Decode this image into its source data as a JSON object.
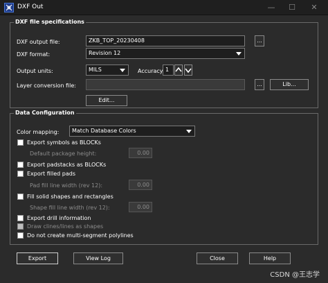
{
  "window": {
    "title": "DXF Out",
    "minimize": "—",
    "maximize": "☐",
    "close": "✕"
  },
  "spec_group": {
    "title": "DXF file specifications",
    "output_file_label": "DXF output file:",
    "output_file_value": "ZKB_TOP_20230408",
    "browse_label": "...",
    "format_label": "DXF format:",
    "format_value": "Revision 12",
    "units_label": "Output units:",
    "units_value": "MILS",
    "accuracy_label": "Accuracy:",
    "accuracy_value": "1",
    "layer_label": "Layer conversion file:",
    "layer_value": "",
    "layer_browse_label": "...",
    "lib_label": "Lib...",
    "edit_label": "Edit..."
  },
  "data_group": {
    "title": "Data Configuration",
    "color_mapping_label": "Color mapping:",
    "color_mapping_value": "Match Database Colors",
    "options": [
      {
        "label": "Export symbols as BLOCKs",
        "checked": false,
        "enabled": true
      },
      {
        "label": "Export padstacks as BLOCKs",
        "checked": false,
        "enabled": true
      },
      {
        "label": "Export filled pads",
        "checked": false,
        "enabled": true
      },
      {
        "label": "Fill solid shapes and rectangles",
        "checked": false,
        "enabled": true
      },
      {
        "label": "Export drill information",
        "checked": false,
        "enabled": true
      },
      {
        "label": "Draw clines/lines as shapes",
        "checked": false,
        "enabled": false
      },
      {
        "label": "Do not create multi-segment polylines",
        "checked": false,
        "enabled": true
      }
    ],
    "default_height_label": "Default package height:",
    "default_height_value": "0.00",
    "pad_fill_label": "Pad fill line width (rev 12):",
    "pad_fill_value": "0.00",
    "shape_fill_label": "Shape fill line width (rev 12):",
    "shape_fill_value": "0.00"
  },
  "footer": {
    "export_label": "Export",
    "view_log_label": "View Log",
    "close_label": "Close",
    "help_label": "Help"
  },
  "watermark": "CSDN @王志学"
}
